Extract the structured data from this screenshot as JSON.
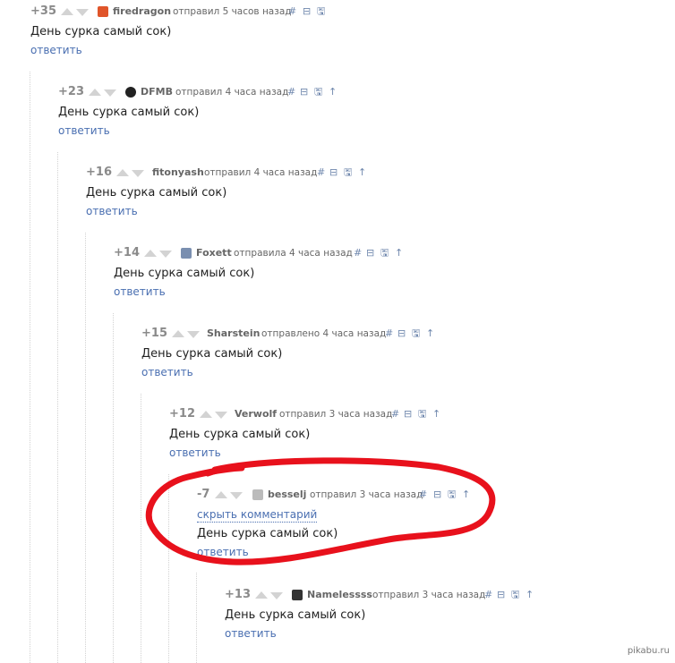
{
  "comments": [
    {
      "rating": "+35",
      "user": "firedragon",
      "meta": "отправил 5 часов назад",
      "text": "День сурка самый сок)",
      "reply": "ответить",
      "avatar_color": "#e0552a"
    },
    {
      "rating": "+23",
      "user": "DFMB",
      "meta": "отправил 4 часа назад",
      "text": "День сурка самый сок)",
      "reply": "ответить",
      "avatar_color": "#222222"
    },
    {
      "rating": "+16",
      "user": "fitonyash",
      "meta": "отправил 4 часа назад",
      "text": "День сурка самый сок)",
      "reply": "ответить",
      "avatar_color": ""
    },
    {
      "rating": "+14",
      "user": "Foxett",
      "meta": "отправила 4 часа назад",
      "text": "День сурка самый сок)",
      "reply": "ответить",
      "avatar_color": "#7a8fb0"
    },
    {
      "rating": "+15",
      "user": "Sharstein",
      "meta": "отправлено 4 часа назад",
      "text": "День сурка самый сок)",
      "reply": "ответить",
      "avatar_color": ""
    },
    {
      "rating": "+12",
      "user": "Verwolf",
      "meta": "отправил 3 часа назад",
      "text": "День сурка самый сок)",
      "reply": "ответить",
      "avatar_color": ""
    },
    {
      "rating": "-7",
      "user": "besselj",
      "meta": "отправил 3 часа назад",
      "text": "День сурка самый сок)",
      "reply": "ответить",
      "hide": "скрыть комментарий",
      "avatar_color": "#bbbbbb"
    },
    {
      "rating": "+13",
      "user": "Namelessss",
      "meta": "отправил 3 часа назад",
      "text": "День сурка самый сок)",
      "reply": "ответить",
      "avatar_color": "#333333"
    }
  ],
  "actions": {
    "anchor": "#",
    "collapse": "⊟",
    "save": "🖫",
    "parent": "↑"
  },
  "icons": {
    "vote_up": "arrow-up-icon",
    "vote_down": "arrow-down-icon",
    "collapse": "collapse-icon",
    "save": "save-icon",
    "parent": "parent-arrow-icon"
  },
  "annotation_color": "#e8111c",
  "watermark": "pikabu.ru"
}
